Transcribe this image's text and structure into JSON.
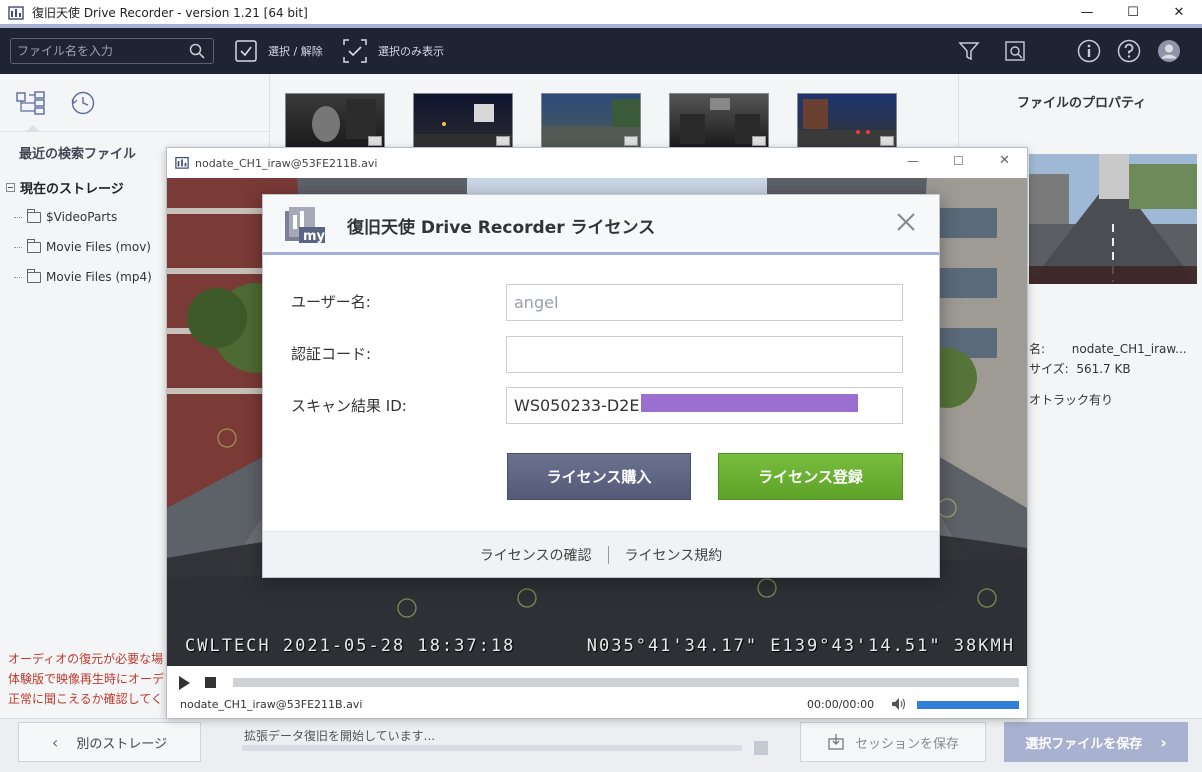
{
  "window": {
    "title": "復旧天使 Drive Recorder - version 1.21 [64 bit]",
    "minimize": "—",
    "maximize": "☐",
    "close": "✕"
  },
  "toolbar": {
    "search_placeholder": "ファイル名を入力",
    "select_toggle_label": "選択 / 解除",
    "show_selected_label": "選択のみ表示"
  },
  "sidebar": {
    "recent_label": "最近の検索ファイル",
    "storage_label": "現在のストレージ",
    "folders": [
      "$VideoParts",
      "Movie Files (mov)",
      "Movie Files (mp4)"
    ],
    "warning_lines": [
      "オーディオの復元が必要な場",
      "体験版で映像再生時にオーデ",
      "正常に聞こえるか確認してく"
    ]
  },
  "properties": {
    "title": "ファイルのプロパティ",
    "name_label": "名:",
    "name_value": "nodate_CH1_iraw...",
    "size_label": "サイズ:",
    "size_value": "561.7 KB",
    "audio_label": "オトラック有り"
  },
  "bottombar": {
    "other_storage": "別のストレージ",
    "progress_text": "拡張データ復旧を開始しています...",
    "progress": 0,
    "save_session": "セッションを保存",
    "save_selected": "選択ファイルを保存"
  },
  "player": {
    "title": "nodate_CH1_iraw@53FE211B.avi",
    "osd_left": "CWLTECH 2021-05-28 18:37:18",
    "osd_right": "N035°41'34.17\"  E139°43'14.51\"   38KMH",
    "file_label": "nodate_CH1_iraw@53FE211B.avi",
    "time": "00:00/00:00",
    "volume": 1
  },
  "dialog": {
    "title": "復旧天使 Drive Recorder ライセンス",
    "username_label": "ユーザー名:",
    "username_value": "angel",
    "auth_label": "認証コード:",
    "auth_value": "",
    "scan_label": "スキャン結果 ID:",
    "scan_value": "WS050233-D2E",
    "buy_button": "ライセンス購入",
    "register_button": "ライセンス登録",
    "check_link": "ライセンスの確認",
    "terms_link": "ライセンス規約"
  },
  "colors": {
    "toolbar_bg": "#1f2433",
    "accent": "#a9b1d4",
    "register_green": "#6db234",
    "buy_slate": "#5e6482",
    "volume_blue": "#2f80d6",
    "warning_red": "#c0392b",
    "redaction": "#9b6fd0"
  },
  "icons": {
    "search": "search-icon",
    "filter": "filter-icon",
    "info": "info-icon",
    "help": "help-icon",
    "user": "user-avatar-icon",
    "tree": "tree-view-icon",
    "history": "history-icon"
  }
}
